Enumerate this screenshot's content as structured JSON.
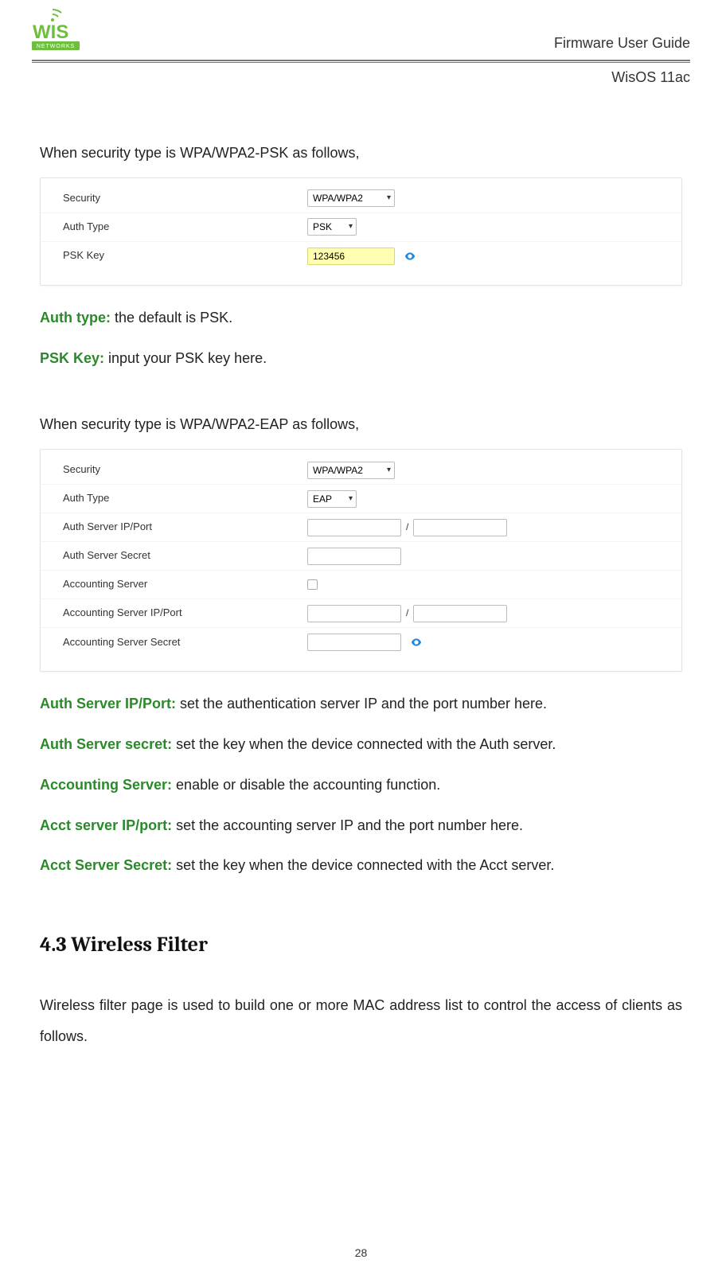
{
  "header": {
    "title": "Firmware User Guide",
    "subtitle": "WisOS 11ac",
    "brand_top": "WIS",
    "brand_bottom": "NETWORKS"
  },
  "intro_psk": "When security type is WPA/WPA2-PSK as follows,",
  "panel_psk": {
    "rows": {
      "security": {
        "label": "Security",
        "value": "WPA/WPA2"
      },
      "authType": {
        "label": "Auth Type",
        "value": "PSK"
      },
      "pskKey": {
        "label": "PSK Key",
        "value": "123456"
      }
    }
  },
  "desc_psk": [
    {
      "term": "Auth type: ",
      "text": "the default is PSK."
    },
    {
      "term": "PSK Key: ",
      "text": "input your PSK key here."
    }
  ],
  "intro_eap": "When security type is WPA/WPA2-EAP as follows,",
  "panel_eap": {
    "rows": {
      "security": {
        "label": "Security",
        "value": "WPA/WPA2"
      },
      "authType": {
        "label": "Auth Type",
        "value": "EAP"
      },
      "authIpPort": {
        "label": "Auth Server IP/Port",
        "ip": "",
        "port": ""
      },
      "authSecret": {
        "label": "Auth Server Secret",
        "value": ""
      },
      "acctServer": {
        "label": "Accounting Server",
        "checked": false
      },
      "acctIpPort": {
        "label": "Accounting Server IP/Port",
        "ip": "",
        "port": ""
      },
      "acctSecret": {
        "label": "Accounting Server Secret",
        "value": ""
      }
    }
  },
  "slash": "/",
  "desc_eap": [
    {
      "term": "Auth Server IP/Port: ",
      "text": "set the authentication server IP and the port number here."
    },
    {
      "term": "Auth Server secret: ",
      "text": "set the key when the device connected with the Auth server."
    },
    {
      "term": "Accounting Server: ",
      "text": "enable or disable the accounting function."
    },
    {
      "term": "Acct server IP/port: ",
      "text": "set the accounting server IP and the port number here."
    },
    {
      "term": "Acct Server Secret: ",
      "text": "set the key when the device connected with the Acct server."
    }
  ],
  "section": {
    "heading": "4.3 Wireless Filter",
    "body": "Wireless filter page is used to build one or more MAC address list to control the access of clients as follows."
  },
  "page_number": "28"
}
